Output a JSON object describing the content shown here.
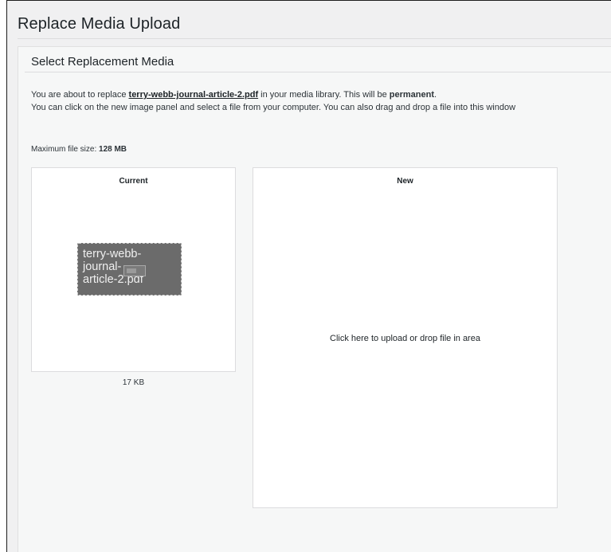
{
  "page": {
    "title": "Replace Media Upload"
  },
  "section": {
    "title": "Select Replacement Media"
  },
  "description": {
    "line1_prefix": "You are about to replace ",
    "filename_link": "terry-webb-journal-article-2.pdf",
    "line1_middle": " in your media library. This will be ",
    "permanent_word": "permanent",
    "line1_suffix": ".",
    "line2": "You can click on the new image panel and select a file from your computer. You can also drag and drop a file into this window"
  },
  "max_file_size": {
    "label": "Maximum file size: ",
    "value": "128 MB"
  },
  "current": {
    "label": "Current",
    "thumbnail_text": "terry-webb-journal-article-2.pdf",
    "thumbnail_lines": [
      "terry-webb-",
      "journal-",
      "article-2.pdf"
    ],
    "file_size": "17 KB",
    "icon": "broken-image-icon"
  },
  "new": {
    "label": "New",
    "upload_prompt": "Click here to upload or drop file in area"
  }
}
